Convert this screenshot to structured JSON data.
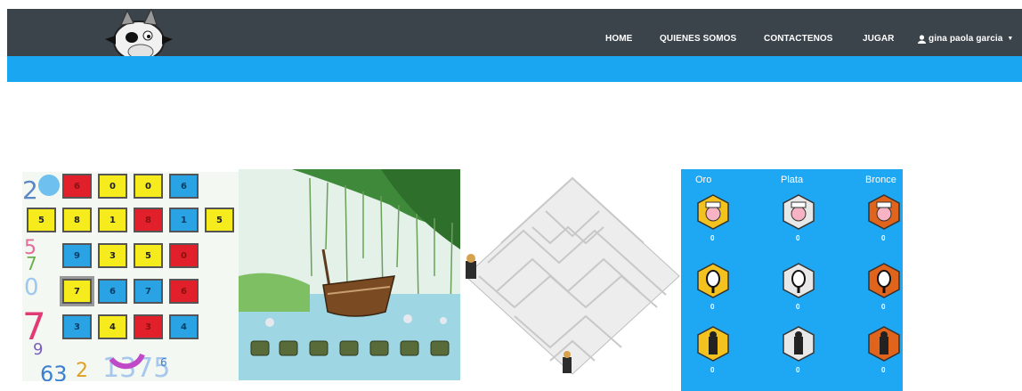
{
  "nav": {
    "home": "HOME",
    "about": "QUIENES SOMOS",
    "contact": "CONTACTENOS",
    "play": "JUGAR",
    "user": "gina paola garcia"
  },
  "games": {
    "numbers_grid": [
      [
        "r",
        "6"
      ],
      [
        "y",
        "0"
      ],
      [
        "y",
        "0"
      ],
      [
        "b",
        "6"
      ],
      [
        "y",
        "5"
      ],
      [
        "y",
        "8"
      ],
      [
        "y",
        "1"
      ],
      [
        "r",
        "8"
      ],
      [
        "b",
        "1"
      ],
      [
        "y",
        "5"
      ],
      [
        "b",
        "9"
      ],
      [
        "y",
        "3"
      ],
      [
        "y",
        "5"
      ],
      [
        "r",
        "0"
      ],
      [
        "y",
        "7"
      ],
      [
        "b",
        "6"
      ],
      [
        "b",
        "7"
      ],
      [
        "r",
        "6"
      ],
      [
        "b",
        "3"
      ],
      [
        "y",
        "4"
      ],
      [
        "r",
        "3"
      ],
      [
        "b",
        "4"
      ]
    ]
  },
  "medals": {
    "headers": [
      "Oro",
      "Plata",
      "Bronce"
    ],
    "scores": [
      "0",
      "0",
      "0",
      "0",
      "0",
      "0",
      "0",
      "0",
      "0"
    ],
    "colors": {
      "gold": "#f4c21f",
      "silver": "#e8e8e8",
      "bronze": "#e0641c"
    }
  },
  "colors": {
    "navbar": "#3b434b",
    "accent": "#1aa6f0"
  }
}
